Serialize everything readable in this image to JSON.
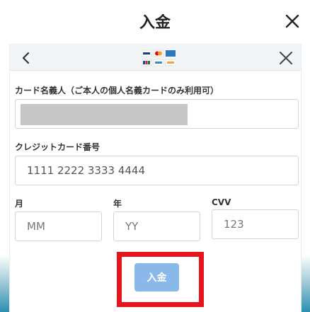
{
  "header": {
    "title": "入金"
  },
  "form": {
    "cardholder_label": "カード名義人（ご本人の個人名義カードのみ利用可）",
    "card_number_label": "クレジットカード番号",
    "card_number_value": "1111 2222 3333 4444",
    "month_label": "月",
    "month_placeholder": "MM",
    "year_label": "年",
    "year_placeholder": "YY",
    "cvv_label": "CVV",
    "cvv_placeholder": "123",
    "submit_label": "入金"
  },
  "icons": {
    "close": "close-icon",
    "back": "chevron-left-icon",
    "card_brands": "card-brand-logos-icon"
  },
  "colors": {
    "submit_button": "#8ab8eb",
    "highlight_border": "#e8141b",
    "panel_header": "#f1f5f7",
    "masked_value": "#c6c6c6"
  }
}
